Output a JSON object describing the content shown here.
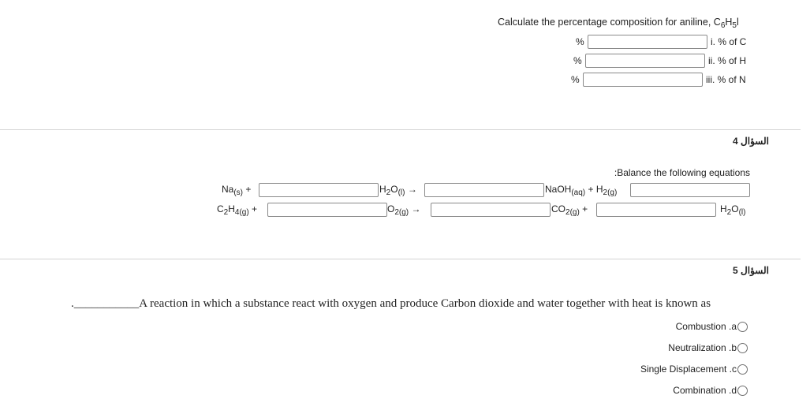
{
  "question3": {
    "prompt": "Calculate the percentage composition for aniline, C",
    "formula_sub1": "6",
    "formula_h": "H",
    "formula_sub2": "5",
    "formula_tail": "l",
    "rows": [
      {
        "unit": "%",
        "value": "",
        "label": "i. % of C"
      },
      {
        "unit": "%",
        "value": "",
        "label": "ii. % of H"
      },
      {
        "unit": "%",
        "value": "",
        "label": "iii. % of N"
      }
    ]
  },
  "question4": {
    "header": "السؤال 4",
    "instruction": ":Balance the following equations",
    "eq1": {
      "reactant1": "Na",
      "reactant1_state": "(s)",
      "plus1": "+",
      "reactant2": "H",
      "reactant2_sub": "2",
      "reactant2_tail": "O",
      "reactant2_state": "(l)",
      "arrow": "→",
      "product1": "NaOH",
      "product1_state": "(aq)",
      "plus2": "+",
      "product2": "H",
      "product2_sub": "2",
      "product2_state": "(g)",
      "inputs": [
        "",
        "",
        ""
      ]
    },
    "eq2": {
      "reactant1": "C",
      "reactant1_sub1": "2",
      "reactant1_h": "H",
      "reactant1_sub2": "4",
      "reactant1_state": "(g)",
      "plus1": "+",
      "reactant2": "O",
      "reactant2_sub": "2",
      "reactant2_state": "(g)",
      "arrow": "→",
      "product1": "CO",
      "product1_sub": "2",
      "product1_state": "(g)",
      "plus2": "+",
      "product2": "H",
      "product2_sub": "2",
      "product2_tail": "O",
      "product2_state": "(l)",
      "inputs": [
        "",
        "",
        "",
        ""
      ]
    }
  },
  "question5": {
    "header": "السؤال 5",
    "blank": ".___________",
    "prompt": "A reaction in which a substance react with oxygen and produce Carbon dioxide and water  together with heat is known as",
    "options": [
      {
        "label": "Combustion .a",
        "selected": false
      },
      {
        "label": "Neutralization .b",
        "selected": false
      },
      {
        "label": "Single Displacement .c",
        "selected": false
      },
      {
        "label": "Combination .d",
        "selected": false
      }
    ]
  }
}
